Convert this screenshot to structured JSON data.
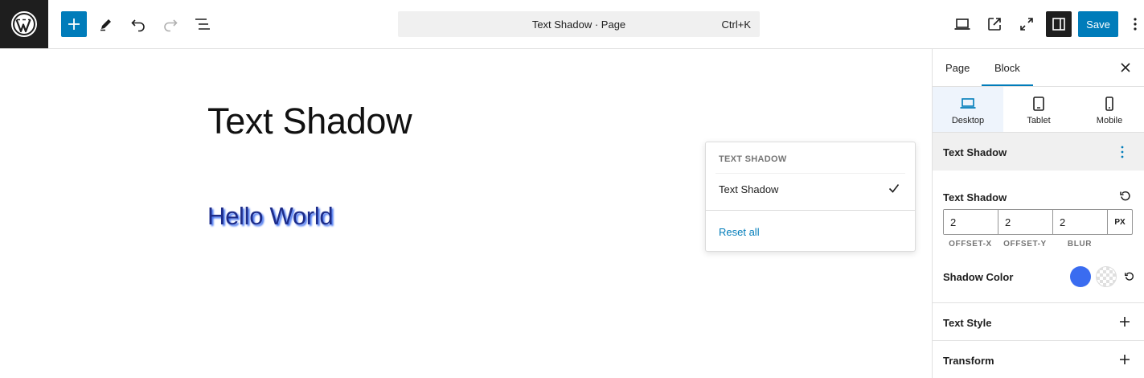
{
  "topbar": {
    "command_title": "Text Shadow · Page",
    "command_shortcut": "Ctrl+K",
    "save_label": "Save",
    "accent_color": "#007cba"
  },
  "canvas": {
    "title": "Text Shadow",
    "paragraph": "Hello World"
  },
  "popover": {
    "heading": "TEXT SHADOW",
    "item_label": "Text Shadow",
    "item_checked": true,
    "reset_label": "Reset all"
  },
  "sidebar": {
    "tabs": [
      {
        "label": "Page",
        "active": false
      },
      {
        "label": "Block",
        "active": true
      }
    ],
    "devices": [
      {
        "label": "Desktop",
        "icon": "laptop-icon",
        "active": true
      },
      {
        "label": "Tablet",
        "icon": "tablet-icon",
        "active": false
      },
      {
        "label": "Mobile",
        "icon": "mobile-icon",
        "active": false
      }
    ],
    "panel_title": "Text Shadow",
    "text_shadow": {
      "label": "Text Shadow",
      "offset_x": "2",
      "offset_y": "2",
      "blur": "2",
      "unit": "PX",
      "sub_labels": [
        "OFFSET-X",
        "OFFSET-Y",
        "BLUR"
      ]
    },
    "shadow_color": {
      "label": "Shadow Color",
      "value": "#3a6cf0"
    },
    "accordions": [
      {
        "title": "Text Style"
      },
      {
        "title": "Transform"
      }
    ]
  }
}
